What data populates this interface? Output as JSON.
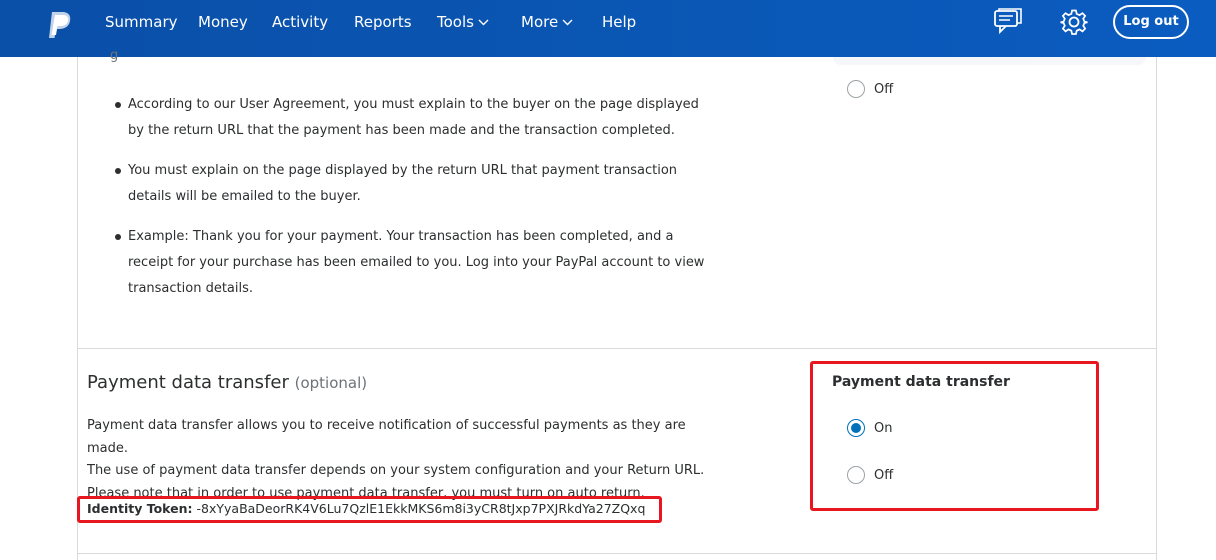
{
  "nav": {
    "items": [
      "Summary",
      "Money",
      "Activity",
      "Reports",
      "Tools",
      "More",
      "Help"
    ],
    "logout_label": "Log out"
  },
  "top": {
    "cut_text": "g",
    "off_label": "Off",
    "bullets": [
      "According to our User Agreement, you must explain to the buyer on the page displayed by the return URL that the payment has been made and the transaction completed.",
      "You must explain on the page displayed by the return URL that payment transaction details will be emailed to the buyer.",
      "Example: Thank you for your payment. Your transaction has been completed, and a receipt for your purchase has been emailed to you. Log into your PayPal account to view transaction details."
    ]
  },
  "pdt": {
    "title": "Payment data transfer",
    "optional": "(optional)",
    "description_lines": [
      "Payment data transfer allows you to receive notification of successful payments as they are made.",
      "The use of payment data transfer depends on your system configuration and your Return URL.",
      "Please note that in order to use payment data transfer, you must turn on auto return."
    ],
    "token_label": "Identity Token:",
    "token_value": "-8xYyaBaDeorRK4V6Lu7QzlE1EkkMKS6m8i3yCR8tJxp7PXJRkdYa27ZQxq",
    "setting_title": "Payment data transfer",
    "on_label": "On",
    "off_label": "Off",
    "selected": "On"
  },
  "colors": {
    "nav_bg": "#0a56b3",
    "highlight": "#e8161e",
    "radio_selected": "#0070ba"
  }
}
